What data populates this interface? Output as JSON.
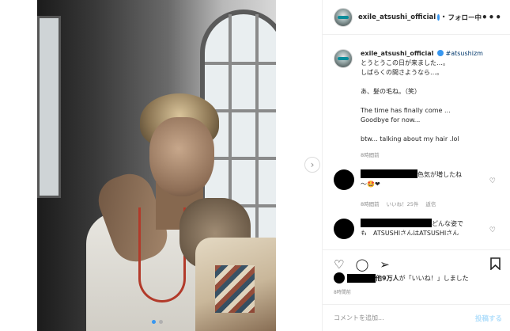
{
  "post": {
    "carousel": {
      "count": 2,
      "active_index": 0
    }
  },
  "header": {
    "username": "exile_atsushi_official",
    "separator": "•",
    "follow_label": "フォロー中",
    "more_label": "•••"
  },
  "caption": {
    "username": "exile_atsushi_official",
    "hashtag": "#atsushizm",
    "lines": [
      "とうとうこの日が来ました…。",
      "しばらくの間さようなら…。",
      "",
      "あ、髪の毛ね。（笑）",
      "",
      "The time has finally come ...",
      "Goodbye for now...",
      "",
      "btw... talking about my hair .lol"
    ],
    "time": "8時間前"
  },
  "comments": [
    {
      "text": "色気が増したね",
      "text2": "〜",
      "emoji": "🤩❤",
      "time": "8時間前",
      "likes": "いいね！25件",
      "reply": "返信"
    },
    {
      "text": "どんな姿で",
      "text2": "も　ATSUSHIさんはATSUSHIさん"
    }
  ],
  "actions": {
    "like_icon": "heart-icon",
    "comment_icon": "comment-icon",
    "share_icon": "share-icon",
    "save_icon": "bookmark-icon"
  },
  "likes": {
    "others": "他9万人",
    "suffix": "が「いいね！」しました"
  },
  "likes_time": "8時間前",
  "comment_input": {
    "placeholder": "コメントを追加...",
    "post_label": "投稿する"
  },
  "colors": {
    "accent": "#3897f0",
    "post_disabled": "#b2dffc",
    "border": "#efefef"
  }
}
